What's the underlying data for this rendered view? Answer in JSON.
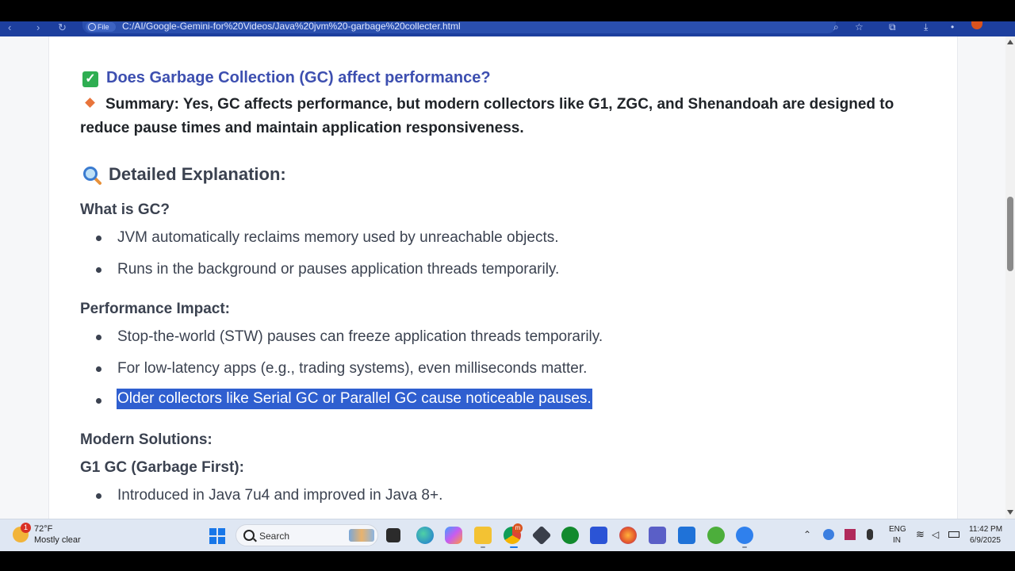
{
  "browser": {
    "site_chip": "File",
    "url": "C:/AI/Google-Gemini-for%20Videos/Java%20jvm%20-garbage%20collecter.html"
  },
  "article": {
    "question": "Does Garbage Collection (GC) affect performance?",
    "summary": "Summary: Yes, GC affects performance, but modern collectors like G1, ZGC, and Shenandoah are designed to reduce pause times and maintain application responsiveness.",
    "detail_heading": "Detailed Explanation:",
    "sections": [
      {
        "heading": "What is GC?",
        "bullets": [
          "JVM automatically reclaims memory used by unreachable objects.",
          "Runs in the background or pauses application threads temporarily."
        ]
      },
      {
        "heading": "Performance Impact:",
        "bullets": [
          "Stop-the-world (STW) pauses can freeze application threads temporarily.",
          "For low-latency apps (e.g., trading systems), even milliseconds matter.",
          "Older collectors like Serial GC or Parallel GC cause noticeable pauses."
        ]
      },
      {
        "heading": "Modern Solutions:",
        "bullets": []
      },
      {
        "heading": "G1 GC (Garbage First):",
        "bullets": [
          "Introduced in Java 7u4 and improved in Java 8+."
        ]
      }
    ]
  },
  "taskbar": {
    "weather_badge": "1",
    "temperature": "72°F",
    "condition": "Mostly clear",
    "search_label": "Search",
    "chrome_badge": "m",
    "lang_line1": "ENG",
    "lang_line2": "IN",
    "time": "11:42 PM",
    "date": "6/9/2025"
  },
  "colors": {
    "accent_blue": "#3d4fb0",
    "selection": "#2f5fd0",
    "check_green": "#2fae52",
    "diamond_orange": "#e8743b",
    "browser_bar": "#1d3f9e"
  }
}
